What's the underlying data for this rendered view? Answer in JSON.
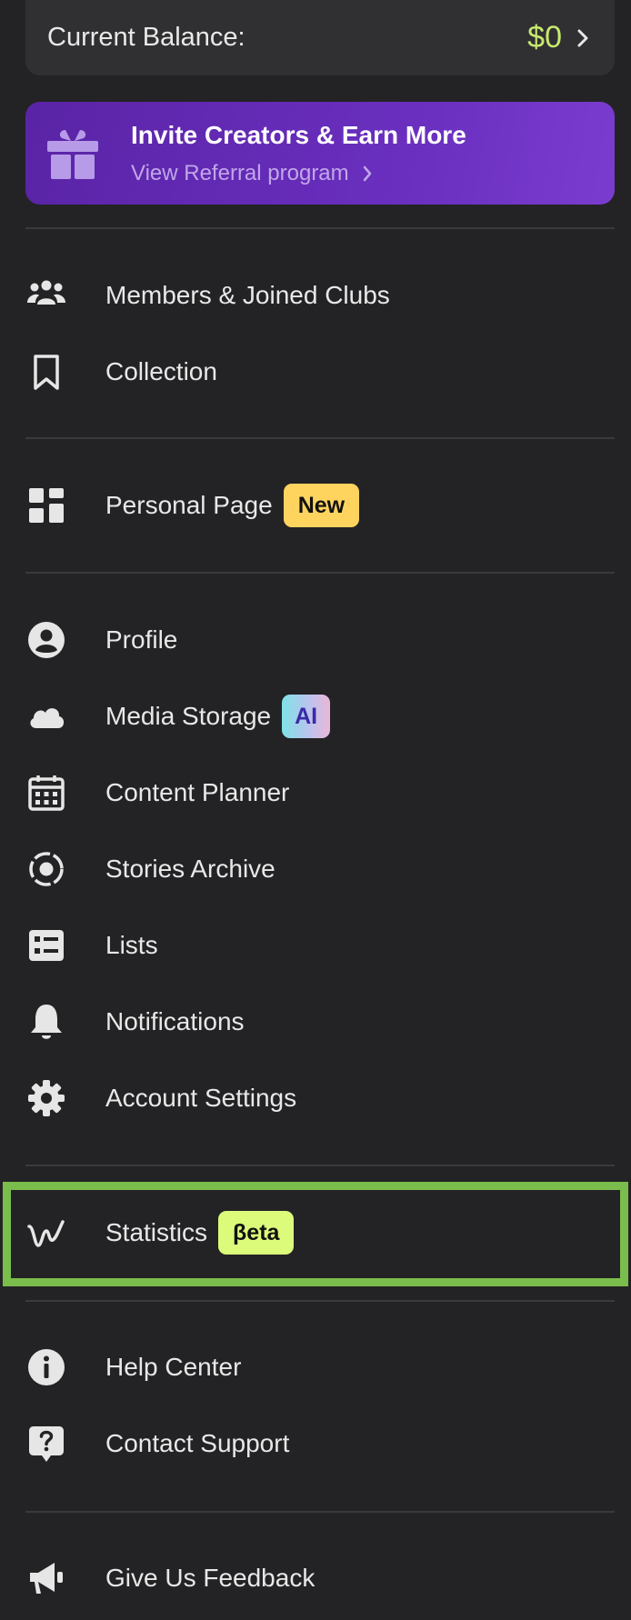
{
  "balance": {
    "label": "Current Balance:",
    "value": "$0"
  },
  "referral": {
    "title": "Invite Creators & Earn More",
    "subtitle": "View Referral program"
  },
  "menu": {
    "members": "Members & Joined Clubs",
    "collection": "Collection",
    "personal_page": {
      "label": "Personal Page",
      "badge": "New"
    },
    "profile": "Profile",
    "media_storage": {
      "label": "Media Storage",
      "badge": "AI"
    },
    "content_planner": "Content Planner",
    "stories_archive": "Stories Archive",
    "lists": "Lists",
    "notifications": "Notifications",
    "account_settings": "Account Settings",
    "statistics": {
      "label": "Statistics",
      "badge": "βeta"
    },
    "help_center": "Help Center",
    "contact_support": "Contact Support",
    "feedback": "Give Us Feedback"
  },
  "colors": {
    "background": "#232325",
    "balance_value": "#c7ea6e",
    "referral_start": "#5a24a6",
    "badge_new": "#ffd45e",
    "badge_beta": "#dcfb7a",
    "highlight": "#7bbd4c"
  }
}
